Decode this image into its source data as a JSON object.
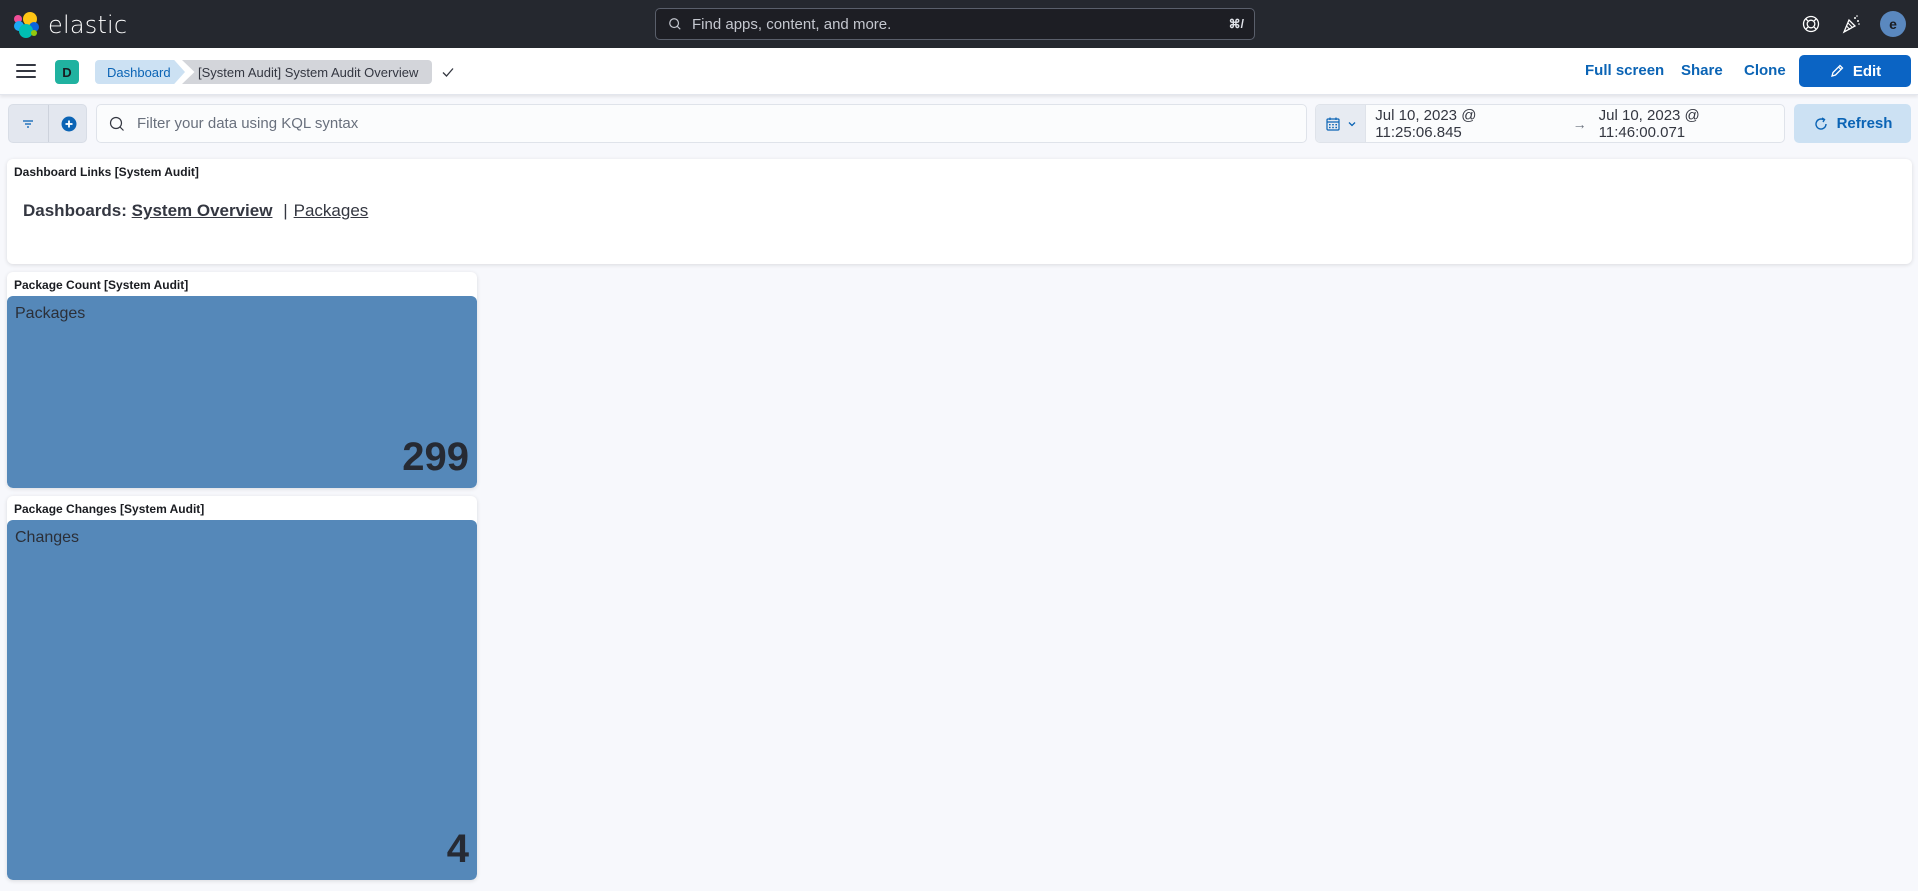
{
  "header": {
    "brand": "elastic",
    "search_placeholder": "Find apps, content, and more.",
    "search_shortcut": "⌘/",
    "user_initial": "e"
  },
  "appbar": {
    "space_initial": "D",
    "breadcrumbs": [
      "Dashboard",
      "[System Audit] System Audit Overview"
    ],
    "actions": {
      "full_screen": "Full screen",
      "share": "Share",
      "clone": "Clone",
      "edit": "Edit"
    }
  },
  "query_bar": {
    "kql_placeholder": "Filter your data using KQL syntax",
    "time_start": "Jul 10, 2023 @ 11:25:06.845",
    "time_end": "Jul 10, 2023 @ 11:46:00.071",
    "arrow": "→",
    "refresh": "Refresh"
  },
  "panels": {
    "links": {
      "title": "Dashboard Links [System Audit]",
      "label": "Dashboards:",
      "links": [
        "System Overview",
        "Packages"
      ],
      "separator": "|"
    },
    "package_count": {
      "title": "Package Count [System Audit]",
      "metric_label": "Packages",
      "value": "299"
    },
    "package_changes": {
      "title": "Package Changes [System Audit]",
      "metric_label": "Changes",
      "value": "4"
    }
  },
  "colors": {
    "primary": "#0b64c4",
    "metric_background": "#5588b9",
    "header_background": "#25282f"
  }
}
